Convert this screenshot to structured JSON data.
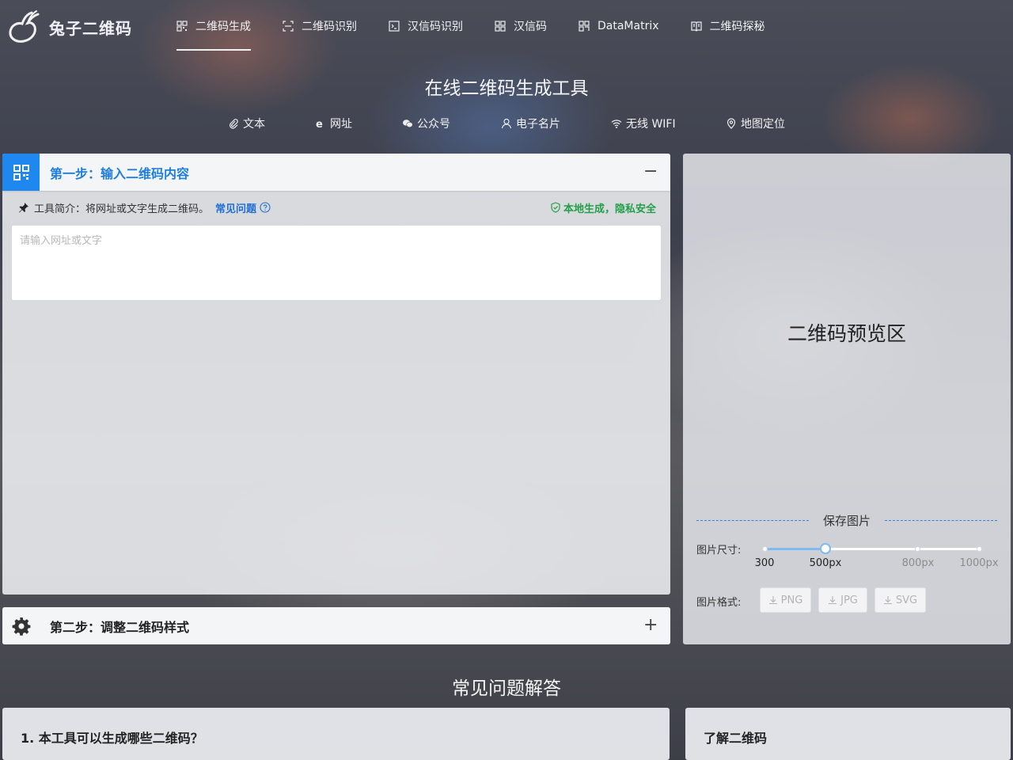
{
  "brand": {
    "name": "兔子二维码"
  },
  "nav": {
    "items": [
      {
        "label": "二维码生成",
        "icon": "qrcode-icon",
        "active": true
      },
      {
        "label": "二维码识别",
        "icon": "scan-icon",
        "active": false
      },
      {
        "label": "汉信码识别",
        "icon": "terminal-icon",
        "active": false
      },
      {
        "label": "汉信码",
        "icon": "hanxin-icon",
        "active": false
      },
      {
        "label": "DataMatrix",
        "icon": "datamatrix-icon",
        "active": false
      },
      {
        "label": "二维码探秘",
        "icon": "book-icon",
        "active": false
      }
    ]
  },
  "page": {
    "title": "在线二维码生成工具"
  },
  "type_tabs": [
    {
      "label": "文本",
      "icon": "paperclip-icon"
    },
    {
      "label": "网址",
      "icon": "browser-e-icon"
    },
    {
      "label": "公众号",
      "icon": "wechat-icon"
    },
    {
      "label": "电子名片",
      "icon": "user-icon"
    },
    {
      "label": "无线 WIFI",
      "icon": "wifi-icon"
    },
    {
      "label": "地图定位",
      "icon": "location-icon"
    }
  ],
  "step1": {
    "title": "第一步：输入二维码内容",
    "toggle": "−",
    "intro": "工具简介：将网址或文字生成二维码。",
    "faq_link": "常见问题",
    "local_badge": "本地生成，隐私安全",
    "input": {
      "value": "",
      "placeholder": "请输入网址或文字"
    },
    "accent": "#1e88f0"
  },
  "step2": {
    "title": "第二步：调整二维码样式",
    "toggle": "+"
  },
  "preview": {
    "label": "二维码预览区",
    "save_title": "保存图片",
    "size_label": "图片尺寸:",
    "size_options": [
      "300",
      "500px",
      "800px",
      "1000px"
    ],
    "size_value": "500px",
    "format_label": "图片格式:",
    "formats": [
      "PNG",
      "JPG",
      "SVG"
    ]
  },
  "faq": {
    "title": "常见问题解答",
    "first_question": "1. 本工具可以生成哪些二维码？",
    "side_title": "了解二维码"
  }
}
